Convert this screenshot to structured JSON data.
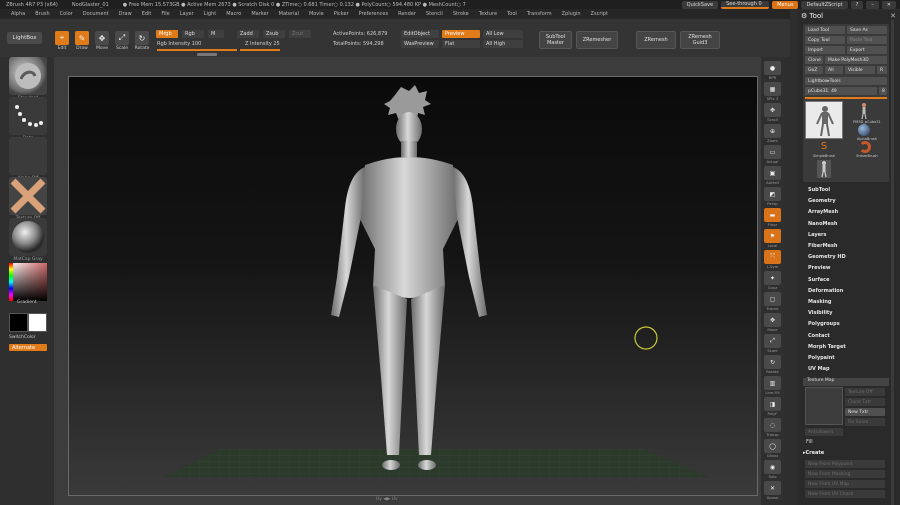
{
  "titlebar": {
    "segments": [
      "ZBrush 4R7 P3 (x64)",
      "NodGlaster_01",
      "● Free Mem 15.573GB ● Active Mem 2673 ● Scratch Disk 0 ● ZTime○ 0.681 Timer○ 0.132 ● PolyCount○ 594.480 KP ● MeshCount○ 7"
    ],
    "quicksave": "QuickSave",
    "seethrough": "See-through 0",
    "menus": "Menus",
    "defaultscript": "DefaultZScript"
  },
  "menubar": [
    "Alpha",
    "Brush",
    "Color",
    "Document",
    "Draw",
    "Edit",
    "File",
    "Layer",
    "Light",
    "Macro",
    "Marker",
    "Material",
    "Movie",
    "Picker",
    "Preferences",
    "Render",
    "Stencil",
    "Stroke",
    "Texture",
    "Tool",
    "Transform",
    "Zplugin",
    "Zscript"
  ],
  "topshelf": {
    "lightbox": "LightBox",
    "edit": "Edit",
    "draw": "Draw",
    "move": "Move",
    "scale": "Scale",
    "rotate": "Rotate",
    "mrgb": "Mrgb",
    "rgb": "Rgb",
    "m": "M",
    "zadd": "Zadd",
    "zsub": "Zsub",
    "zcut": "Zcut",
    "rgb_intensity": "Rgb Intensity 100",
    "z_intensity": "Z Intensity 25",
    "active_points": "ActivePoints: 626,879",
    "total_points": "TotalPoints: 594,298",
    "edit_object": "EditObject",
    "was_preview": "WasPreview",
    "preview": "Preview",
    "flat": "Flat",
    "all_low": "All Low",
    "all_high": "All High",
    "subtool_master": "SubTool Master",
    "zremesher": "ZRemesher",
    "zremesh": "ZRemesh",
    "zremesh_guides": "ZRemesh Guid3"
  },
  "leftshelf": {
    "brush_label": "Standard",
    "stroke_label": "Dots",
    "alpha_label": "Alpha Off",
    "texture_label": "Texture Off",
    "material_label": "MatCap Gray",
    "gradient": "Gradient",
    "switchcolor": "SwitchColor",
    "alternate": "Alternate"
  },
  "rightshelf": [
    "BPR",
    "SPix 3",
    "Scroll",
    "Zoom",
    "Actual",
    "AAHalf",
    "Persp",
    "Floor",
    "Local",
    "L.Sym",
    "Gxyz",
    "Frame",
    "Move",
    "Scale",
    "Rotate",
    "Line Fill",
    "PolyF",
    "Transp",
    "Ghost",
    "Solo",
    "Xpose"
  ],
  "palette": {
    "title": "Tool",
    "buttons": [
      "Load Tool",
      "Save As",
      "Copy Tool",
      "Paste Tool",
      "Import",
      "Export",
      "Clone",
      "Make PolyMesh3D",
      "GoZ",
      "All",
      "Visible",
      "R"
    ],
    "lightbox_tools": "Lightbox▸Tools",
    "pcube": "pCube31. 49",
    "pcube_count": "8",
    "thumbs": [
      "PM3D_pCube31",
      "PM3D_pCube31",
      "AlphaBrush",
      "SimpleBrush",
      "EraserBrush",
      "PM3D_pCube31"
    ],
    "menu": [
      "SubTool",
      "Geometry",
      "ArrayMesh",
      "NanoMesh",
      "Layers",
      "FiberMesh",
      "Geometry HD",
      "Preview",
      "Surface",
      "Deformation",
      "Masking",
      "Visibility",
      "Polygroups",
      "Contact",
      "Morph Target",
      "Polypaint",
      "UV Map",
      "Texture Map"
    ],
    "texture_sub": [
      "Texture Off",
      "Clone Txtr",
      "New Txtr",
      "Fix Seam",
      "Antialiased",
      "Fill"
    ],
    "create": "▸Create",
    "disabled": [
      "New From Polypaint",
      "New From Masking",
      "New From UV Map",
      "New From UV Check"
    ]
  },
  "canvas": {
    "bottom_label": "Uy ◀▶ Uv"
  }
}
